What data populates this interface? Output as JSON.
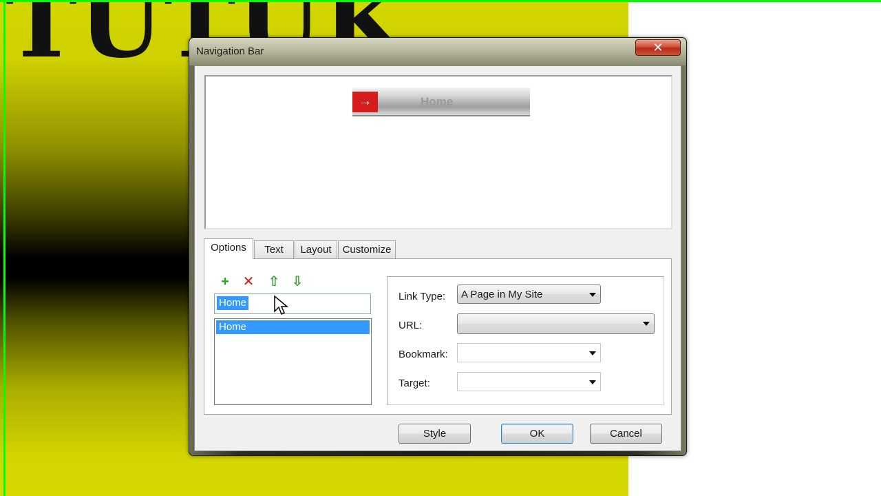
{
  "background": {
    "stencil_text": "TUTUK",
    "guide_color": "#00ff00",
    "gradient_colors": [
      "#d4d600",
      "#000000"
    ]
  },
  "dialog": {
    "title": "Navigation Bar",
    "close_glyph": "✕",
    "preview": {
      "button_label": "Home",
      "arrow_glyph": "→",
      "arrow_color": "#d71c1c"
    },
    "tabs": [
      {
        "label": "Options",
        "active": true
      },
      {
        "label": "Text",
        "active": false
      },
      {
        "label": "Layout",
        "active": false
      },
      {
        "label": "Customize",
        "active": false
      }
    ],
    "toolbar": {
      "add_icon": "add-item-icon",
      "remove_icon": "remove-item-icon",
      "move_up_icon": "arrow-up-icon",
      "move_down_icon": "arrow-down-icon",
      "add_glyph": "+",
      "remove_glyph": "✕",
      "up_glyph": "⇧",
      "down_glyph": "⇩"
    },
    "item_name_input": {
      "value": "Home"
    },
    "item_list": [
      {
        "label": "Home",
        "selected": true
      }
    ],
    "link_settings": {
      "link_type": {
        "label": "Link Type:",
        "value": "A Page in My Site"
      },
      "url": {
        "label": "URL:",
        "value": ""
      },
      "bookmark": {
        "label": "Bookmark:",
        "value": ""
      },
      "target": {
        "label": "Target:",
        "value": ""
      }
    },
    "buttons": {
      "style": "Style",
      "ok": "OK",
      "cancel": "Cancel"
    },
    "selection_color": "#3399ff"
  }
}
